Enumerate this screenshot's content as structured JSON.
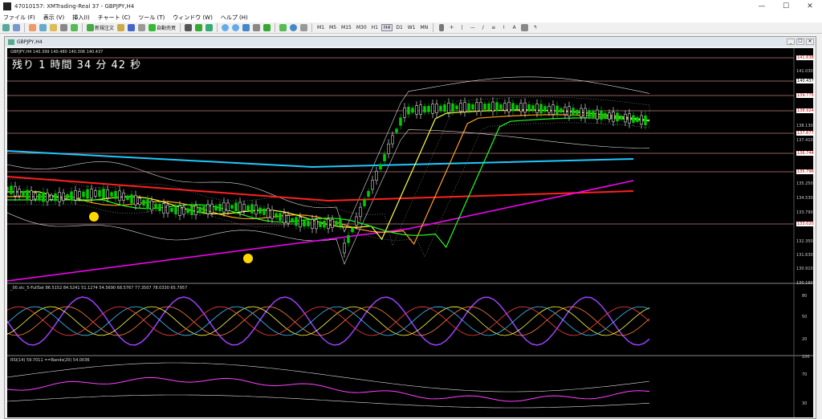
{
  "window": {
    "title": "47010157: XMTrading-Real 37 - GBPJPY,H4",
    "controls": [
      "—",
      "☐",
      "✕"
    ]
  },
  "menu": {
    "items": [
      "ファイル (F)",
      "表示 (V)",
      "挿入(I)",
      "チャート (C)",
      "ツール (T)",
      "ウィンドウ (W)",
      "ヘルプ (H)"
    ]
  },
  "toolbar": {
    "new_order_label": "新規注文",
    "auto_trade_label": "自動売買",
    "timeframes": [
      "M1",
      "M5",
      "M15",
      "M30",
      "H1",
      "H4",
      "D1",
      "W1",
      "MN"
    ],
    "active_timeframe": "H4",
    "text_tool": "A"
  },
  "chart_window": {
    "title": "GBPJPY,H4",
    "controls": [
      "_",
      "☐",
      "✕"
    ]
  },
  "main_pane": {
    "ohlc_label": "GBPJPY,H4  140.399 140.480 140.306 140.437",
    "countdown": "残り 1 時間 34 分 42 秒",
    "price_scale": [
      "141.650",
      "141.030",
      "140.437",
      "139.753",
      "138.924",
      "138.130",
      "137.877",
      "137.410",
      "136.744",
      "135.796",
      "135.250",
      "134.530",
      "133.790",
      "133.020",
      "132.350",
      "131.630",
      "130.910",
      "130.190"
    ],
    "level_tags": [
      {
        "price": "141.638",
        "type": "level"
      },
      {
        "price": "140.437",
        "type": "current"
      },
      {
        "price": "139.775",
        "type": "level"
      },
      {
        "price": "138.924",
        "type": "level"
      },
      {
        "price": "137.877",
        "type": "level"
      },
      {
        "price": "136.744",
        "type": "level"
      },
      {
        "price": "135.796",
        "type": "level"
      },
      {
        "price": "133.020",
        "type": "level"
      }
    ]
  },
  "stoch_pane": {
    "label": "_00.stc_5-FullSet 86.5152 84.5241 51.1274 54.5690 68.5767 77.3507 78.0330 65.7957",
    "scale": [
      "80",
      "50",
      "20"
    ]
  },
  "rsi_pane": {
    "label": "RSI(14) 59.7011   ==Bands(20) 54.0036",
    "scale": [
      "100",
      "70",
      "30"
    ]
  },
  "colors": {
    "bull_candle": "#00cc00",
    "bear_candle": "#ffffff",
    "ma_red": "#ff2020",
    "ma_cyan": "#20c8ff",
    "ma_magenta": "#ff00ff",
    "ma_orange": "#ffa020",
    "ma_yellow": "#ffff40",
    "ma_green": "#20ff20",
    "level_line": "#c08080",
    "stoch_purple": "#a040ff"
  }
}
